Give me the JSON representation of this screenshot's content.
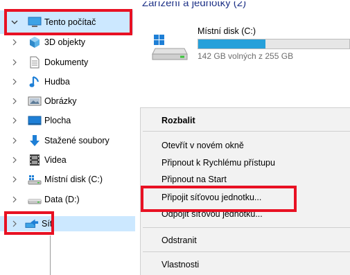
{
  "nav": {
    "items": [
      {
        "label": "Tento počítač",
        "icon": "monitor-icon",
        "expanded": true
      },
      {
        "label": "3D objekty",
        "icon": "3d-objects-icon"
      },
      {
        "label": "Dokumenty",
        "icon": "document-icon"
      },
      {
        "label": "Hudba",
        "icon": "music-note-icon"
      },
      {
        "label": "Obrázky",
        "icon": "pictures-icon"
      },
      {
        "label": "Plocha",
        "icon": "desktop-icon"
      },
      {
        "label": "Stažené soubory",
        "icon": "download-arrow-icon"
      },
      {
        "label": "Videa",
        "icon": "video-film-icon"
      },
      {
        "label": "Místní disk (C:)",
        "icon": "windows-drive-icon"
      },
      {
        "label": "Data (D:)",
        "icon": "drive-icon"
      },
      {
        "label": "Síť",
        "icon": "network-icon"
      }
    ]
  },
  "main": {
    "section_title": "Zařízení a jednotky (2)",
    "drive": {
      "name": "Místní disk (C:)",
      "free_text": "142 GB volných z 255 GB",
      "used_fraction": 0.443
    }
  },
  "context_menu": {
    "items": [
      {
        "label": "Rozbalit",
        "bold": true
      },
      {
        "label": "Otevřít v novém okně"
      },
      {
        "label": "Připnout k Rychlému přístupu"
      },
      {
        "label": "Připnout na Start"
      },
      {
        "label": "Připojit síťovou jednotku..."
      },
      {
        "label": "Odpojit síťovou jednotku..."
      },
      {
        "label": "Odstranit"
      },
      {
        "label": "Vlastnosti"
      }
    ]
  },
  "colors": {
    "selection": "#cce8ff",
    "highlight": "#e81123",
    "accent": "#26a0da",
    "folder_blue": "#1e7fd6"
  }
}
